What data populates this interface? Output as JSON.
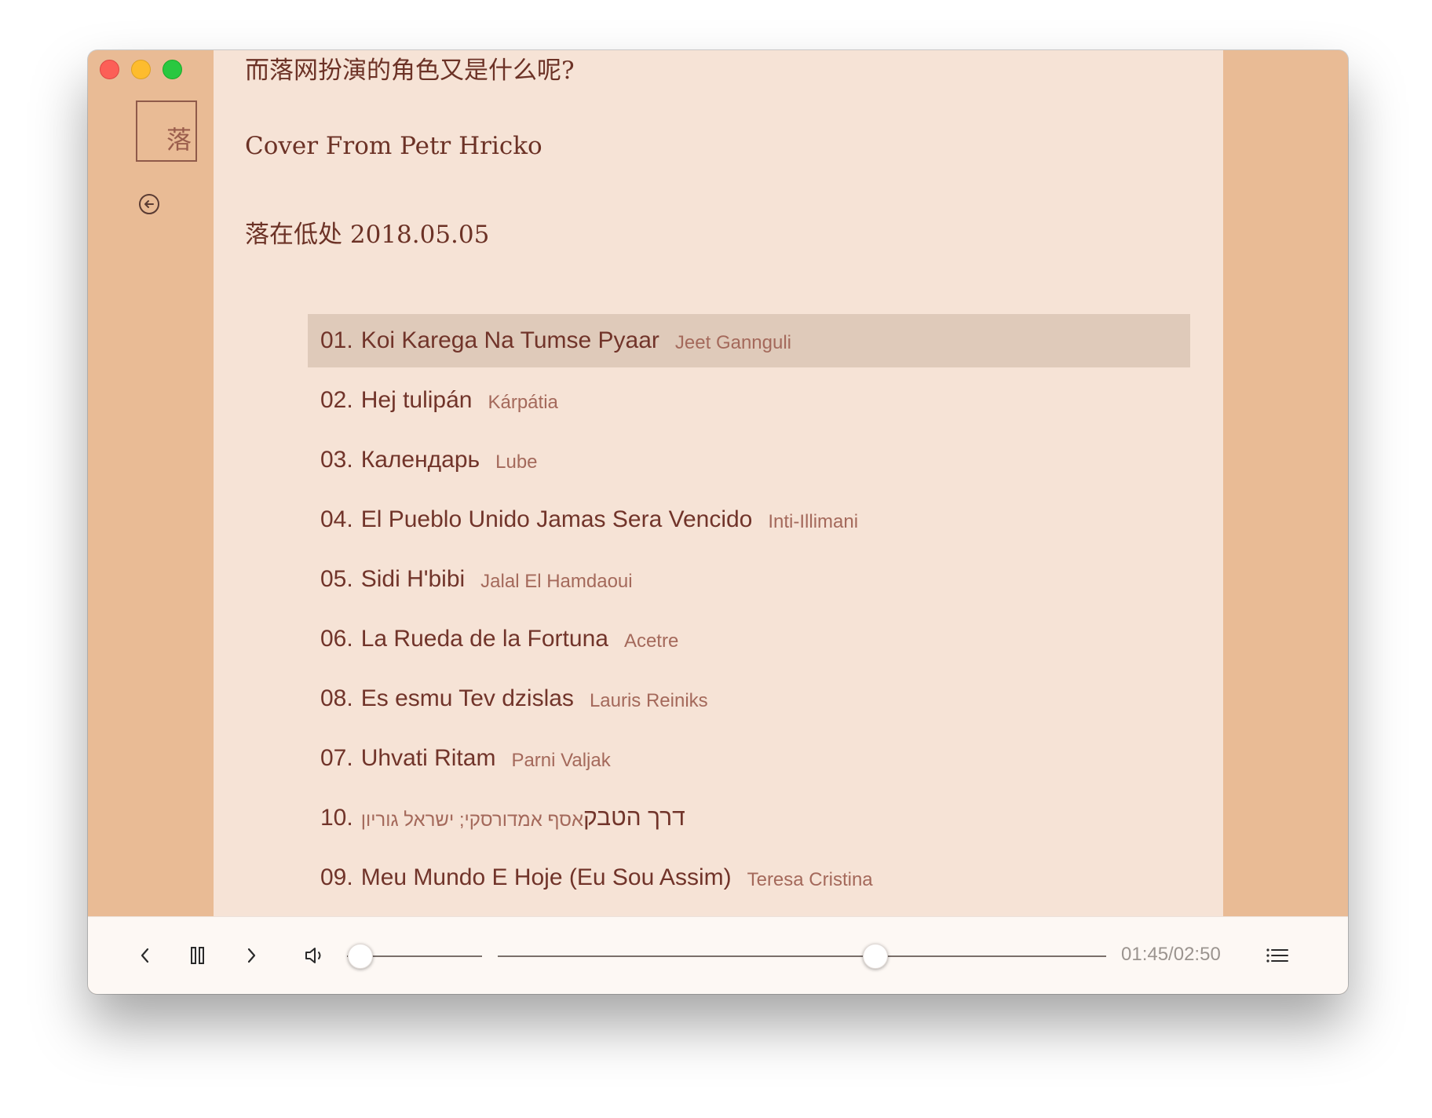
{
  "window": {
    "traffic_lights": [
      "close",
      "minimize",
      "zoom"
    ]
  },
  "sidebar": {
    "logo_text": "落",
    "back_icon": "circle-arrow-left-icon"
  },
  "album": {
    "question": "而落网扮演的角色又是什么呢?",
    "cover_credit": "Cover From Petr Hricko",
    "signature": "落在低处 2018.05.05"
  },
  "tracks": [
    {
      "num": "01.",
      "title": "Koi Karega Na Tumse Pyaar",
      "artist": "Jeet Gannguli",
      "active": true
    },
    {
      "num": "02.",
      "title": "Hej tulipán",
      "artist": "Kárpátia"
    },
    {
      "num": "03.",
      "title": "Календарь",
      "artist": "Lube"
    },
    {
      "num": "04.",
      "title": "El Pueblo Unido Jamas Sera Vencido",
      "artist": "Inti-Illimani"
    },
    {
      "num": "05.",
      "title": "Sidi H'bibi",
      "artist": "Jalal El Hamdaoui"
    },
    {
      "num": "06.",
      "title": "La Rueda de la Fortuna",
      "artist": "Acetre"
    },
    {
      "num": "08.",
      "title": "Es esmu Tev dzislas",
      "artist": "Lauris Reiniks"
    },
    {
      "num": "07.",
      "title": "Uhvati Ritam",
      "artist": "Parni Valjak"
    },
    {
      "num": "10.",
      "title": "דרך הטבק",
      "artist": "אסף אמדורסקי; ישראל גוריון",
      "rtl": true
    },
    {
      "num": "09.",
      "title": "Meu Mundo E Hoje (Eu Sou Assim)",
      "artist": "Teresa Cristina"
    }
  ],
  "player": {
    "prev_icon": "chevron-left-icon",
    "pause_icon": "pause-icon",
    "next_icon": "chevron-right-icon",
    "volume_icon": "speaker-icon",
    "playlist_icon": "list-icon",
    "volume_level": 0.1,
    "progress_level": 0.62,
    "time": "01:45/02:50"
  }
}
